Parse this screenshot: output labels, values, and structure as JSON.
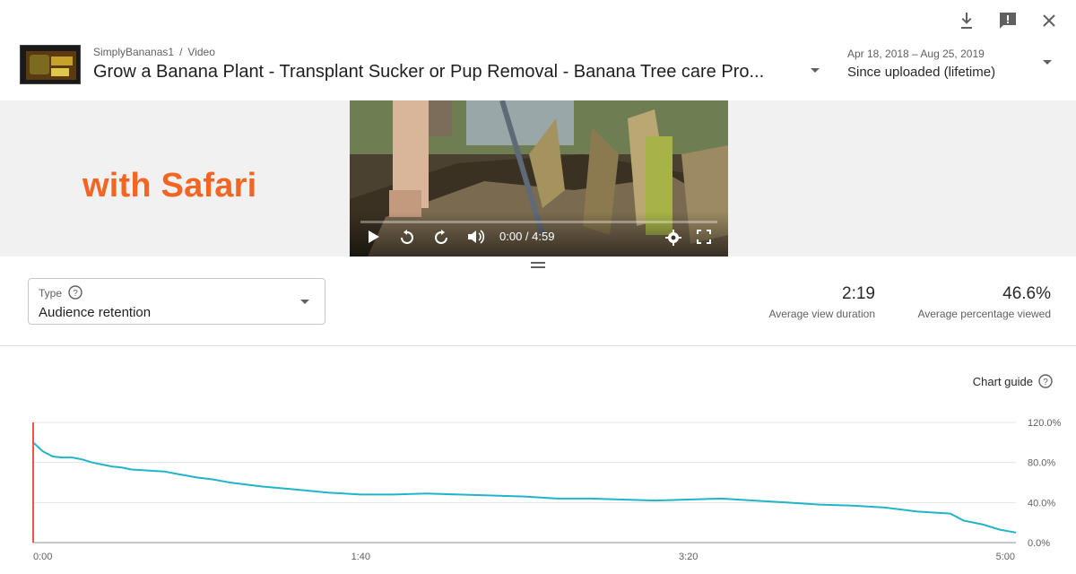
{
  "header": {
    "channel": "SimplyBananas1",
    "separator": "/",
    "crumb_section": "Video",
    "title": "Grow a Banana Plant - Transplant Sucker or Pup Removal - Banana Tree care Pro...",
    "date_range": "Apr 18, 2018 – Aug 25, 2019",
    "period": "Since uploaded (lifetime)"
  },
  "icons": {
    "download": "download-icon",
    "feedback": "feedback-icon",
    "close": "close-icon"
  },
  "banner": {
    "promo_text": "with Safari"
  },
  "player": {
    "time": "0:00 / 4:59",
    "progress": 0
  },
  "type_selector": {
    "label": "Type",
    "value": "Audience retention"
  },
  "stats": {
    "avg_view_duration": "2:19",
    "avg_view_duration_label": "Average view duration",
    "avg_pct_viewed": "46.6%",
    "avg_pct_viewed_label": "Average percentage viewed"
  },
  "chart_guide": "Chart guide",
  "colors": {
    "accent": "#f26522",
    "line": "#22b4c9",
    "cursor": "#ff4e45"
  },
  "chart_data": {
    "type": "line",
    "x_ticks": [
      "0:00",
      "1:40",
      "3:20",
      "5:00"
    ],
    "y_ticks": [
      "120.0%",
      "80.0%",
      "40.0%",
      "0.0%"
    ],
    "ylim": [
      0,
      120
    ],
    "xlim_seconds": [
      0,
      300
    ],
    "grid": true,
    "series": [
      {
        "x": [
          0,
          3,
          6,
          9,
          12,
          15,
          18,
          21,
          24,
          27,
          30,
          35,
          40,
          45,
          50,
          55,
          60,
          70,
          80,
          90,
          100,
          110,
          120,
          130,
          140,
          150,
          160,
          170,
          180,
          190,
          200,
          210,
          220,
          230,
          240,
          250,
          260,
          270,
          280,
          284,
          290,
          295,
          300
        ],
        "y": [
          100,
          91,
          86,
          85,
          85,
          83,
          80,
          78,
          76,
          75,
          73,
          72,
          71,
          68,
          65,
          63,
          60,
          56,
          53,
          50,
          48,
          48,
          49,
          48,
          47,
          46,
          44,
          44,
          43,
          42,
          43,
          44,
          42,
          40,
          38,
          37,
          35,
          31,
          29,
          22,
          18,
          13,
          10
        ]
      }
    ]
  }
}
